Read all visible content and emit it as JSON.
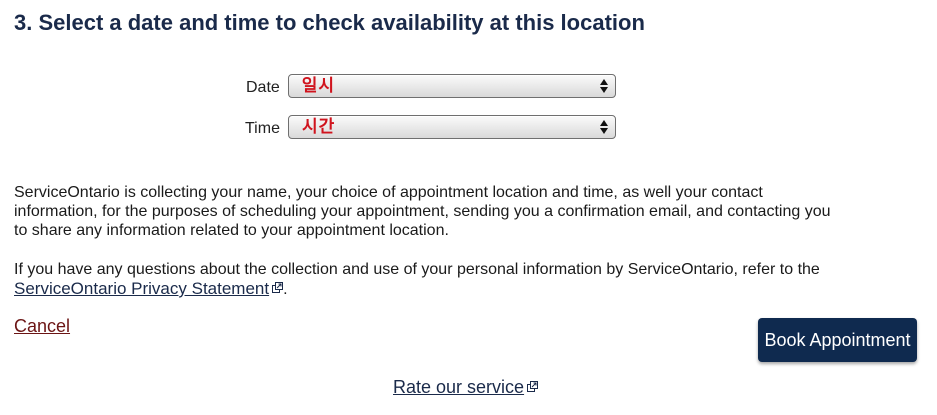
{
  "section": {
    "heading": "3. Select a date and time to check availability at this location"
  },
  "form": {
    "date_label": "Date",
    "date_value": "일시",
    "time_label": "Time",
    "time_value": "시간"
  },
  "privacy": {
    "paragraph1": "ServiceOntario is collecting your name, your choice of appointment location and time, as well your contact information, for the purposes of scheduling your appointment, sending you a confirmation email, and contacting you to share any information related to your appointment location.",
    "paragraph2_text": "If you have any questions about the collection and use of your personal information by ServiceOntario, refer to the",
    "privacy_link": "ServiceOntario Privacy Statement",
    "trailing_period": "."
  },
  "actions": {
    "cancel_label": "Cancel",
    "book_label": "Book Appointment"
  },
  "footer": {
    "rate_label": "Rate our service"
  },
  "icons": {
    "external_link": "external-link-icon",
    "select_arrows": "select-arrows-icon"
  },
  "colors": {
    "heading": "#1a2a4a",
    "select_value": "#d0141e",
    "cancel_link": "#6b1414",
    "button_bg": "#0f2a4f"
  }
}
